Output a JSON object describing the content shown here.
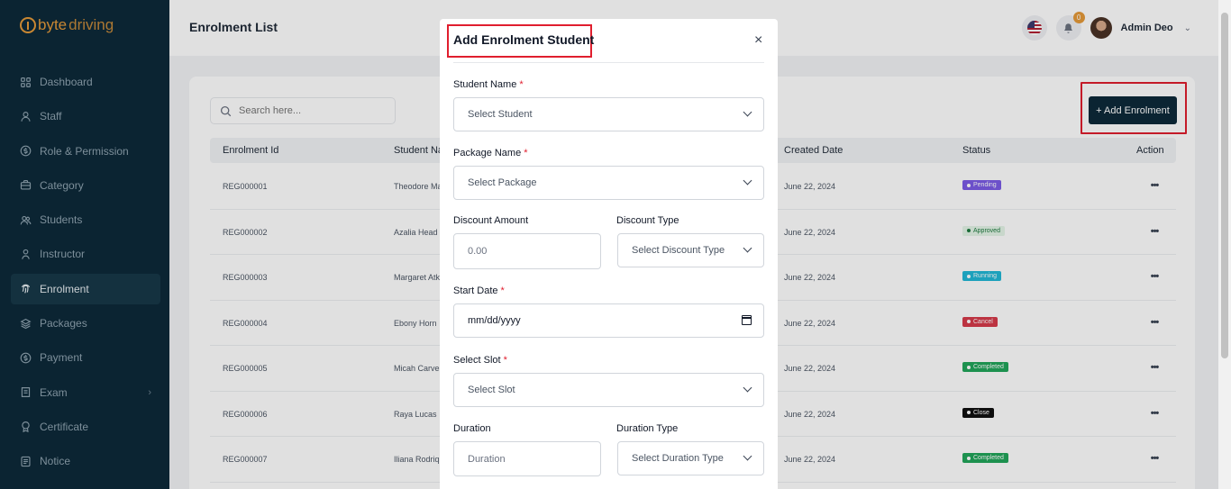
{
  "app": {
    "logo_a": "byte",
    "logo_b": "driving"
  },
  "sidebar": {
    "items": [
      {
        "label": "Dashboard",
        "icon": "grid-icon"
      },
      {
        "label": "Staff",
        "icon": "user-icon"
      },
      {
        "label": "Role & Permission",
        "icon": "dollar-circle-icon"
      },
      {
        "label": "Category",
        "icon": "briefcase-icon"
      },
      {
        "label": "Students",
        "icon": "users-icon"
      },
      {
        "label": "Instructor",
        "icon": "person-icon"
      },
      {
        "label": "Enrolment",
        "icon": "fingerprint-icon",
        "active": true
      },
      {
        "label": "Packages",
        "icon": "layers-icon"
      },
      {
        "label": "Payment",
        "icon": "dollar-circle-icon"
      },
      {
        "label": "Exam",
        "icon": "exam-icon",
        "expandable": true
      },
      {
        "label": "Certificate",
        "icon": "certificate-icon"
      },
      {
        "label": "Notice",
        "icon": "notice-icon"
      }
    ]
  },
  "header": {
    "title": "Enrolment List",
    "notification_count": "0",
    "user_name": "Admin Deo"
  },
  "main": {
    "search_placeholder": "Search here...",
    "add_button": "+ Add Enrolment",
    "columns": [
      "Enrolment Id",
      "Student Na",
      "Created Date",
      "Status",
      "Action"
    ],
    "rows": [
      {
        "id": "REG000001",
        "student": "Theodore Ma",
        "date": "June 22, 2024",
        "status": "Pending"
      },
      {
        "id": "REG000002",
        "student": "Azalia Head",
        "date": "June 22, 2024",
        "status": "Approved"
      },
      {
        "id": "REG000003",
        "student": "Margaret Atk",
        "date": "June 22, 2024",
        "status": "Running"
      },
      {
        "id": "REG000004",
        "student": "Ebony Horn",
        "date": "June 22, 2024",
        "status": "Cancel"
      },
      {
        "id": "REG000005",
        "student": "Micah Carve",
        "date": "June 22, 2024",
        "status": "Completed"
      },
      {
        "id": "REG000006",
        "student": "Raya Lucas",
        "date": "June 22, 2024",
        "status": "Close"
      },
      {
        "id": "REG000007",
        "student": "Iliana Rodriq",
        "date": "June 22, 2024",
        "status": "Completed"
      }
    ],
    "status_colors": {
      "Pending": "#7c5ce6",
      "Approved": "#e4f5e8",
      "Running": "#22b8d6",
      "Cancel": "#d63b4a",
      "Completed": "#22a55a",
      "Close": "#111111"
    }
  },
  "modal": {
    "title": "Add Enrolment Student",
    "close": "×",
    "student_label": "Student Name",
    "student_value": "Select Student",
    "package_label": "Package Name",
    "package_value": "Select Package",
    "discount_amount_label": "Discount Amount",
    "discount_amount_placeholder": "0.00",
    "discount_type_label": "Discount Type",
    "discount_type_value": "Select Discount Type",
    "start_date_label": "Start Date",
    "start_date_placeholder": "mm/dd/yyyy",
    "slot_label": "Select Slot",
    "slot_value": "Select Slot",
    "duration_label": "Duration",
    "duration_placeholder": "Duration",
    "duration_type_label": "Duration Type",
    "duration_type_value": "Select Duration Type",
    "required_mark": "*"
  }
}
